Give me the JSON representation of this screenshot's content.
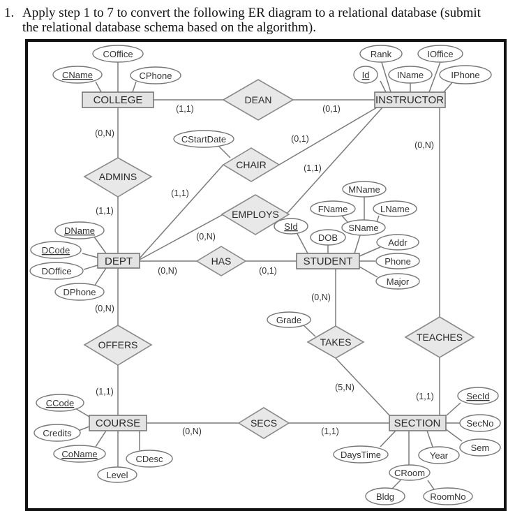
{
  "question": {
    "number": "1.",
    "line1": "Apply step 1 to 7 to convert the following ER diagram to a relational database (submit",
    "line2": "the relational database schema based on the algorithm)."
  },
  "diagram": {
    "entities": {
      "college": "COLLEGE",
      "instructor": "INSTRUCTOR",
      "dept": "DEPT",
      "student": "STUDENT",
      "course": "COURSE",
      "section": "SECTION"
    },
    "relationships": {
      "dean": "DEAN",
      "chair": "CHAIR",
      "admins": "ADMINS",
      "employs": "EMPLOYS",
      "has": "HAS",
      "offers": "OFFERS",
      "takes": "TAKES",
      "teaches": "TEACHES",
      "secs": "SECS"
    },
    "attributes": {
      "coffice": "COffice",
      "cname": "CName",
      "cphone": "CPhone",
      "rank": "Rank",
      "ioffice": "IOffice",
      "id": "Id",
      "iname": "IName",
      "iphone": "IPhone",
      "cstartdate": "CStartDate",
      "dname": "DName",
      "dcode": "DCode",
      "doffice": "DOffice",
      "dphone": "DPhone",
      "mname": "MName",
      "fname": "FName",
      "lname": "LName",
      "sname": "SName",
      "sid": "SId",
      "dob": "DOB",
      "addr": "Addr",
      "phone": "Phone",
      "major": "Major",
      "grade": "Grade",
      "ccode": "CCode",
      "credits": "Credits",
      "coname": "CoName",
      "cdesc": "CDesc",
      "level": "Level",
      "secid": "SecId",
      "secno": "SecNo",
      "sem": "Sem",
      "daystime": "DaysTime",
      "year": "Year",
      "croom": "CRoom",
      "bldg": "Bldg",
      "roomno": "RoomNo"
    },
    "key_attributes": [
      "CName",
      "Id",
      "DName",
      "DCode",
      "SId",
      "CCode",
      "CoName",
      "SecId"
    ],
    "cardinalities": {
      "college_dean": "(1,1)",
      "instructor_dean": "(0,1)",
      "college_admins": "(0,N)",
      "dept_admins": "(1,1)",
      "instructor_chair": "(0,1)",
      "dept_chair": "(1,1)",
      "instructor_employs": "(1,1)",
      "dept_employs": "(0,N)",
      "instructor_teaches": "(0,N)",
      "dept_has": "(0,N)",
      "student_has": "(0,1)",
      "dept_offers": "(0,N)",
      "course_offers": "(1,1)",
      "student_takes": "(0,N)",
      "section_takes": "(5,N)",
      "section_teaches": "(1,1)",
      "course_secs": "(0,N)",
      "section_secs": "(1,1)"
    }
  }
}
